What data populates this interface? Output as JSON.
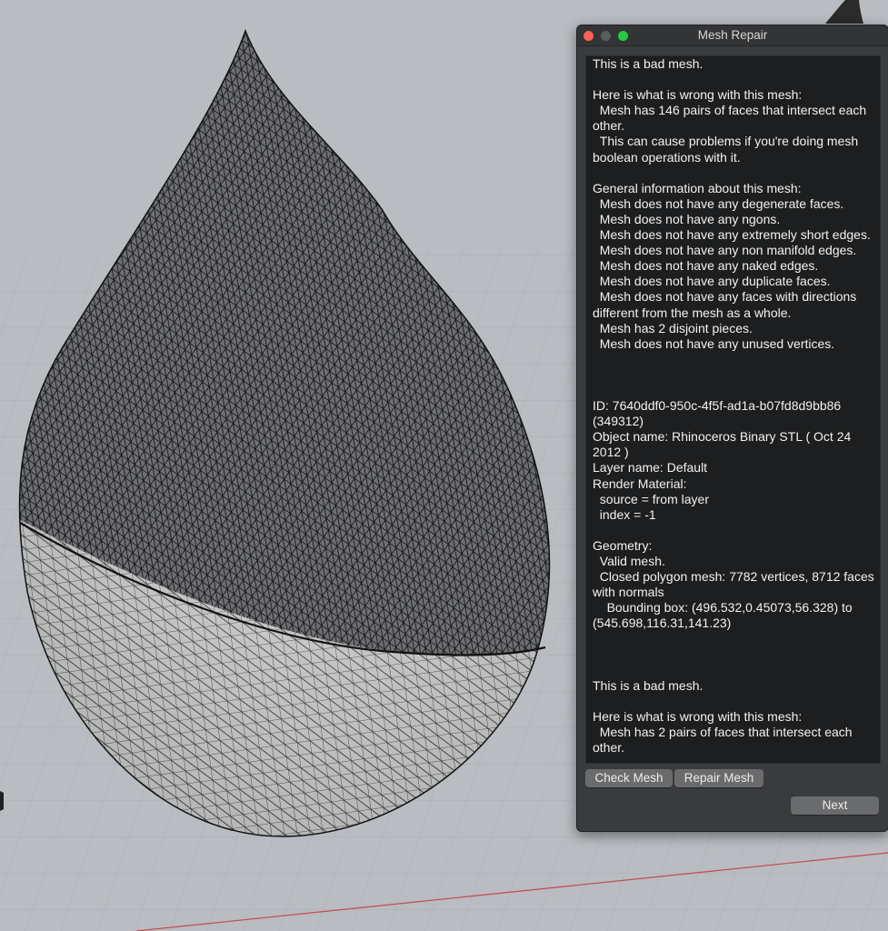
{
  "window": {
    "title": "Mesh Repair"
  },
  "report": {
    "lines": [
      "This is a bad mesh.",
      "",
      "Here is what is wrong with this mesh:",
      "  Mesh has 146 pairs of faces that intersect each other.",
      "  This can cause problems if you're doing mesh boolean operations with it.",
      "",
      "General information about this mesh:",
      "  Mesh does not have any degenerate faces.",
      "  Mesh does not have any ngons.",
      "  Mesh does not have any extremely short edges.",
      "  Mesh does not have any non manifold edges.",
      "  Mesh does not have any naked edges.",
      "  Mesh does not have any duplicate faces.",
      "  Mesh does not have any faces with directions different from the mesh as a whole.",
      "  Mesh has 2 disjoint pieces.",
      "  Mesh does not have any unused vertices.",
      "",
      "",
      "",
      "ID: 7640ddf0-950c-4f5f-ad1a-b07fd8d9bb86 (349312)",
      "Object name: Rhinoceros Binary STL ( Oct 24 2012 )",
      "Layer name: Default",
      "Render Material:",
      "  source = from layer",
      "  index = -1",
      "",
      "Geometry:",
      "  Valid mesh.",
      "  Closed polygon mesh: 7782 vertices, 8712 faces with normals",
      "    Bounding box: (496.532,0.45073,56.328) to (545.698,116.31,141.23)",
      "",
      "",
      "",
      "This is a bad mesh.",
      "",
      "Here is what is wrong with this mesh:",
      "  Mesh has 2 pairs of faces that intersect each other."
    ]
  },
  "buttons": {
    "check_mesh": "Check Mesh",
    "repair_mesh": "Repair Mesh",
    "next": "Next"
  },
  "colors": {
    "viewport_background": "#b9bcc1",
    "grid_line": "#a9acb1",
    "panel_background": "#3a3b3d",
    "report_background": "#1d1e1f",
    "report_text": "#f2f2f2",
    "close_button": "#ff5f57",
    "zoom_button": "#28c840",
    "axis_line": "#c44a4a"
  }
}
